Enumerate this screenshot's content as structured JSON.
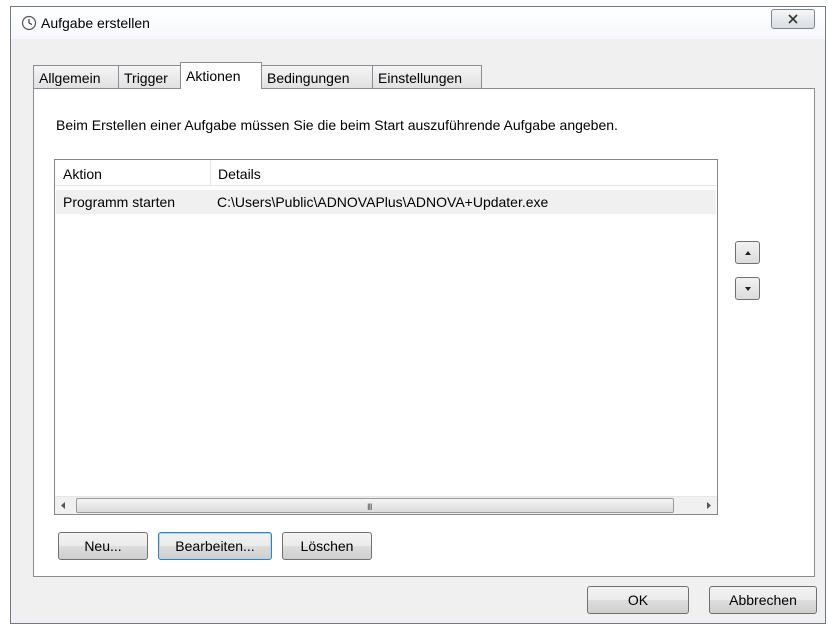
{
  "window": {
    "title": "Aufgabe erstellen"
  },
  "tabs": [
    {
      "label": "Allgemein"
    },
    {
      "label": "Trigger"
    },
    {
      "label": "Aktionen"
    },
    {
      "label": "Bedingungen"
    },
    {
      "label": "Einstellungen"
    }
  ],
  "active_tab": "Aktionen",
  "panel": {
    "instruction": "Beim Erstellen einer Aufgabe müssen Sie die beim Start auszuführende Aufgabe angeben.",
    "columns": [
      "Aktion",
      "Details"
    ],
    "rows": [
      {
        "action": "Programm starten",
        "details": "C:\\Users\\Public\\ADNOVAPlus\\ADNOVA+Updater.exe"
      }
    ],
    "scrollbar_grip": "III",
    "buttons": {
      "new": "Neu...",
      "edit": "Bearbeiten...",
      "delete": "Löschen"
    }
  },
  "footer": {
    "ok": "OK",
    "cancel": "Abbrechen"
  },
  "icons": {
    "title": "clock-icon",
    "close": "close-icon",
    "up": "arrow-up-icon",
    "down": "arrow-down-icon"
  },
  "colors": {
    "selected_row": "#f0f0f0",
    "default_button_border": "#3c7fb1"
  }
}
